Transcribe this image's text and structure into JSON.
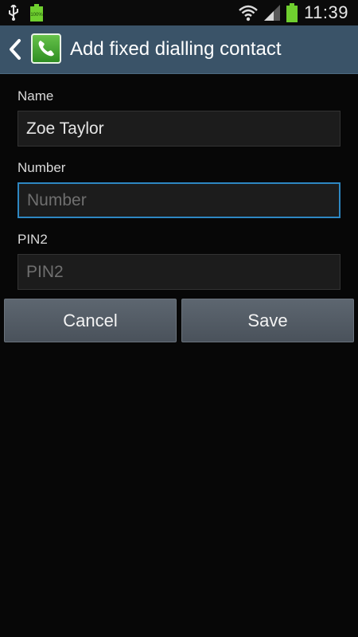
{
  "status_bar": {
    "time": "11:39",
    "battery_small_label": "100%",
    "icons": [
      "usb-icon",
      "battery-full-icon",
      "wifi-icon",
      "signal-icon",
      "battery-icon"
    ]
  },
  "action_bar": {
    "title": "Add fixed dialling contact",
    "icons": [
      "back-arrow-icon",
      "phone-app-icon"
    ]
  },
  "form": {
    "name_label": "Name",
    "name_value": "Zoe Taylor",
    "number_label": "Number",
    "number_placeholder": "Number",
    "number_value": "",
    "pin2_label": "PIN2",
    "pin2_placeholder": "PIN2",
    "pin2_value": ""
  },
  "buttons": {
    "cancel_label": "Cancel",
    "save_label": "Save"
  },
  "colors": {
    "action_bar_bg": "#3a5368",
    "focus_border": "#2e87c2",
    "background": "#070707"
  }
}
